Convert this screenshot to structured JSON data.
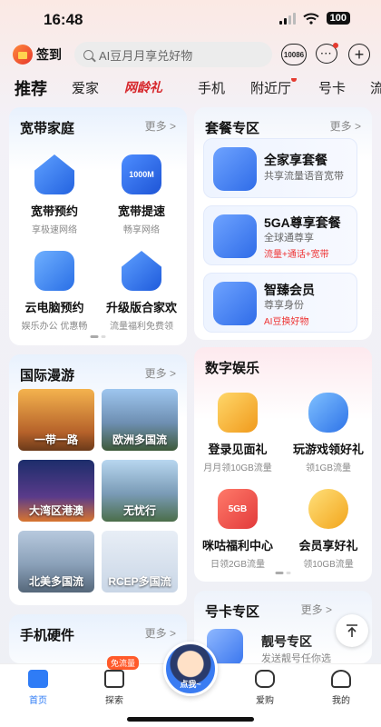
{
  "status": {
    "time": "16:48",
    "battery": "100"
  },
  "top": {
    "signin_label": "签到",
    "search_placeholder": "AI豆月月享兑好物",
    "service_icon_text": "10086",
    "message_icon_text": "···",
    "plus_icon_text": "+"
  },
  "tabs": [
    "推荐",
    "爱家",
    "网龄礼",
    "手机",
    "附近厅",
    "号卡",
    "流"
  ],
  "broadband": {
    "title": "宽带家庭",
    "more": "更多 >",
    "items": [
      {
        "name": "宽带预约",
        "sub": "享极速网络",
        "icon": "wifi-house-icon"
      },
      {
        "name": "宽带提速",
        "sub": "畅享网络",
        "icon": "router-1000m-icon",
        "icon_text": "1000M"
      },
      {
        "name": "云电脑预约",
        "sub": "娱乐办公 优惠畅",
        "icon": "cloud-pc-icon"
      },
      {
        "name": "升级版合家欢",
        "sub": "流量福利免费领",
        "icon": "family-house-icon"
      }
    ]
  },
  "packages": {
    "title": "套餐专区",
    "more": "更多 >",
    "items": [
      {
        "name": "全家享套餐",
        "sub": "共享流量语音宽带",
        "highlight": "",
        "icon_text": "全家享"
      },
      {
        "name": "5GA尊享套餐",
        "sub": "全球通尊享",
        "highlight": "流量+通话+宽带",
        "icon_text": "5GA"
      },
      {
        "name": "智臻会员",
        "sub": "尊享身份",
        "highlight": "AI豆换好物",
        "icon_text": "智臻"
      }
    ]
  },
  "roaming": {
    "title": "国际漫游",
    "more": "更多 >",
    "items": [
      "一带一路",
      "欧洲多国流",
      "大湾区港澳",
      "无忧行",
      "北美多国流",
      "RCEP多国流"
    ]
  },
  "entertainment": {
    "title": "数字娱乐",
    "items": [
      {
        "name": "登录见面礼",
        "sub": "月月领10GB流量",
        "icon": "gift-box-icon"
      },
      {
        "name": "玩游戏领好礼",
        "sub": "领1GB流量",
        "icon": "gamepad-icon"
      },
      {
        "name": "咪咕福利中心",
        "sub": "日领2GB流量",
        "icon": "migu-gift-icon",
        "icon_text": "5GB"
      },
      {
        "name": "会员享好礼",
        "sub": "领10GB流量",
        "icon": "vip-coins-icon"
      }
    ]
  },
  "numbercard": {
    "title": "号卡专区",
    "more": "更多 >",
    "item_name": "靓号专区",
    "item_sub": "发送靓号任你选"
  },
  "hardware": {
    "title": "手机硬件",
    "more": "更多 >"
  },
  "nav": {
    "home": "首页",
    "explore": "探索",
    "free_badge": "免流量",
    "assistant": "点我~",
    "shop": "爱购",
    "mine": "我的"
  },
  "colors": {
    "brand_red": "#d6262b",
    "accent_blue": "#2f7cf6",
    "highlight_red": "#e33333"
  }
}
